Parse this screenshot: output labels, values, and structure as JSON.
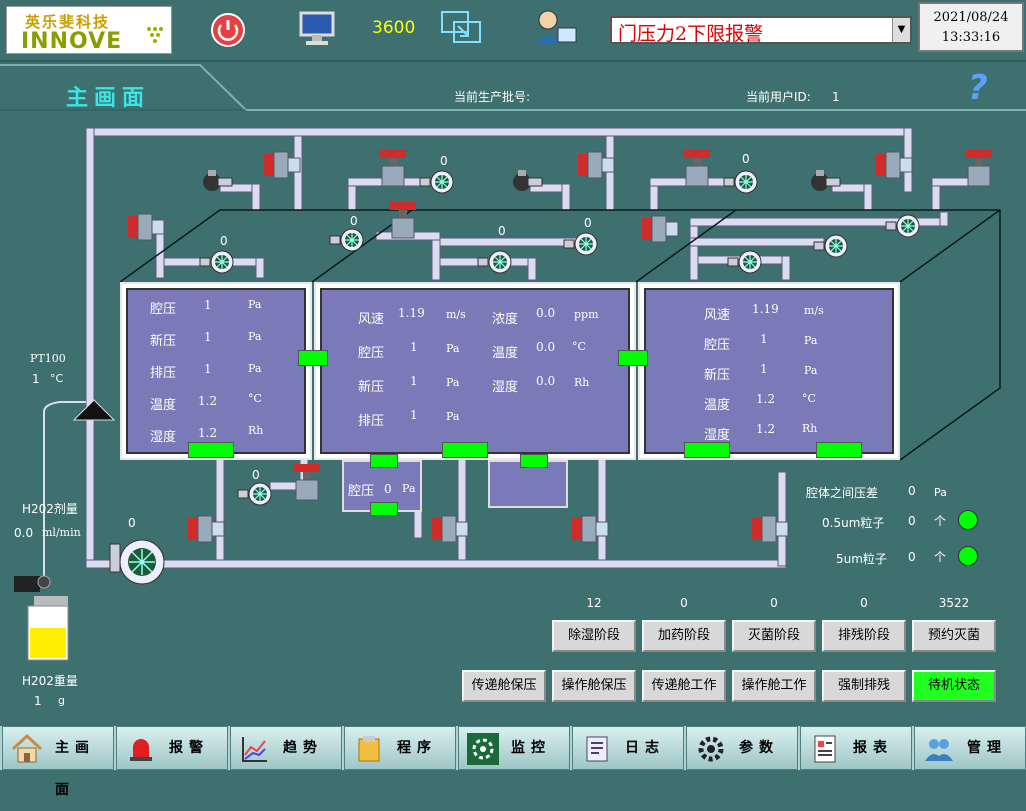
{
  "header": {
    "logo_cn": "英乐斐科技",
    "logo_en_prefix": "INNOVE",
    "counter": "3600",
    "alarm_text": "门压力2下限报警",
    "date": "2021/08/24",
    "time": "13:33:16",
    "page_title": "主画面",
    "batch_label": "当前生产批号:",
    "batch_value": "",
    "user_label": "当前用户ID:",
    "user_value": "1",
    "help_glyph": "?"
  },
  "left": {
    "pt100_label": "PT100",
    "pt100_value": "1",
    "pt100_unit": "°C",
    "h2o2_dose_label": "H202剂量",
    "h2o2_dose_value": "0.0",
    "h2o2_dose_unit": "ml/min",
    "h2o2_weight_label": "H202重量",
    "h2o2_weight_value": "1",
    "h2o2_weight_unit": "g",
    "blower_value": "0"
  },
  "panel1": {
    "rows": [
      {
        "label": "腔压",
        "value": "1",
        "unit": "Pa"
      },
      {
        "label": "新压",
        "value": "1",
        "unit": "Pa"
      },
      {
        "label": "排压",
        "value": "1",
        "unit": "Pa"
      },
      {
        "label": "温度",
        "value": "1.2",
        "unit": "°C"
      },
      {
        "label": "湿度",
        "value": "1.2",
        "unit": "Rh"
      }
    ]
  },
  "panel2": {
    "left_rows": [
      {
        "label": "风速",
        "value": "1.19",
        "unit": "m/s"
      },
      {
        "label": "腔压",
        "value": "1",
        "unit": "Pa"
      },
      {
        "label": "新压",
        "value": "1",
        "unit": "Pa"
      },
      {
        "label": "排压",
        "value": "1",
        "unit": "Pa"
      }
    ],
    "right_rows": [
      {
        "label": "浓度",
        "value": "0.0",
        "unit": "ppm"
      },
      {
        "label": "温度",
        "value": "0.0",
        "unit": "°C"
      },
      {
        "label": "湿度",
        "value": "0.0",
        "unit": "Rh"
      }
    ]
  },
  "panel3": {
    "rows": [
      {
        "label": "风速",
        "value": "1.19",
        "unit": "m/s"
      },
      {
        "label": "腔压",
        "value": "1",
        "unit": "Pa"
      },
      {
        "label": "新压",
        "value": "1",
        "unit": "Pa"
      },
      {
        "label": "温度",
        "value": "1.2",
        "unit": "°C"
      },
      {
        "label": "湿度",
        "value": "1.2",
        "unit": "Rh"
      }
    ]
  },
  "small_chamber": {
    "label": "腔压",
    "value": "0",
    "unit": "Pa"
  },
  "fan_values": [
    "0",
    "0",
    "0",
    "0",
    "0",
    "0",
    "0"
  ],
  "right_info": {
    "diff_label": "腔体之间压差",
    "diff_value": "0",
    "diff_unit": "Pa",
    "p05_label": "0.5um粒子",
    "p05_value": "0",
    "p05_unit": "个",
    "p5_label": "5um粒子",
    "p5_value": "0",
    "p5_unit": "个",
    "indicator_color": "#00ff00"
  },
  "stage_counts": [
    "12",
    "0",
    "0",
    "0",
    "3522"
  ],
  "stage_buttons": [
    "除湿阶段",
    "加药阶段",
    "灭菌阶段",
    "排残阶段",
    "预约灭菌"
  ],
  "action_buttons": [
    "传递舱保压",
    "操作舱保压",
    "传递舱工作",
    "操作舱工作",
    "强制排残",
    "待机状态"
  ],
  "active_color": "#20ff20",
  "nav": [
    "主画面",
    "报警",
    "趋势",
    "程序",
    "监控",
    "日志",
    "参数",
    "报表",
    "管理"
  ]
}
